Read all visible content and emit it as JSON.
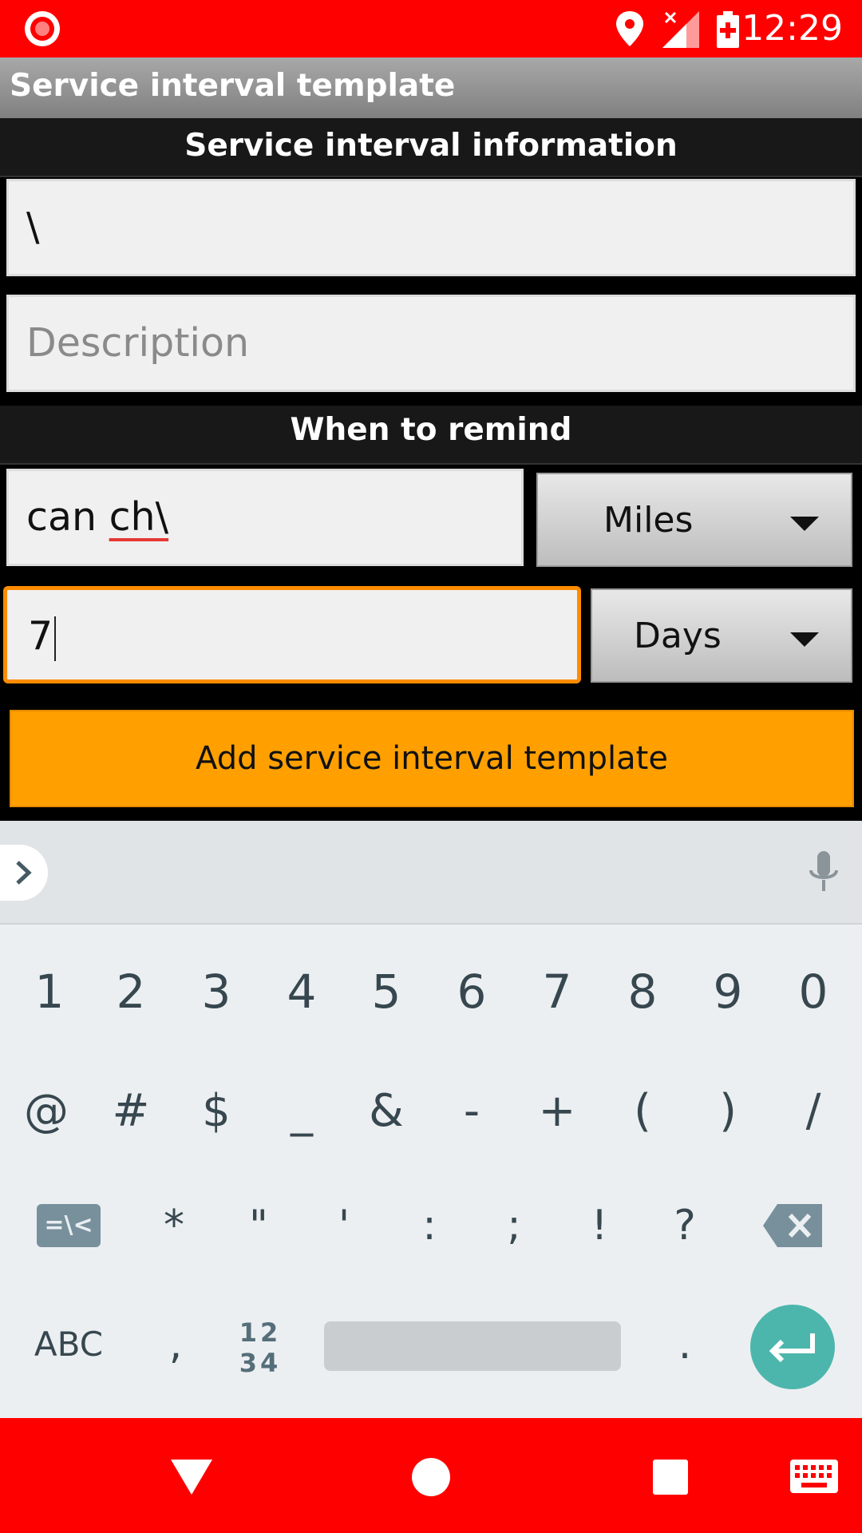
{
  "status_bar": {
    "time": "12:29",
    "icons": [
      "record-icon",
      "location-icon",
      "signal-icon",
      "battery-charging-icon"
    ],
    "color": "#ff0000"
  },
  "title_bar": {
    "title": "Service interval template"
  },
  "sections": {
    "info_header": "Service interval information",
    "remind_header": "When to remind"
  },
  "form": {
    "name_value": "\\",
    "description_placeholder": "Description",
    "miles_value_plain": "can ",
    "miles_value_misspelled": "ch\\",
    "miles_unit": "Miles",
    "days_value": "7",
    "days_unit": "Days",
    "add_button": "Add service interval template"
  },
  "keyboard": {
    "number_row": [
      "1",
      "2",
      "3",
      "4",
      "5",
      "6",
      "7",
      "8",
      "9",
      "0"
    ],
    "symbol_row1": [
      "@",
      "#",
      "$",
      "_",
      "&",
      "-",
      "+",
      "(",
      ")",
      "/"
    ],
    "symbol_row2": [
      "*",
      "\"",
      "'",
      ":",
      ";",
      "!",
      "?"
    ],
    "more_symbols_label": "=\\<",
    "abc_label": "ABC",
    "comma_label": ",",
    "numpad_label_top": "12",
    "numpad_label_bottom": "34",
    "period_label": ".",
    "accent": "#4db6ac"
  },
  "nav_bar": {
    "buttons": [
      "back-icon",
      "home-icon",
      "recents-icon",
      "keyboard-icon"
    ]
  }
}
